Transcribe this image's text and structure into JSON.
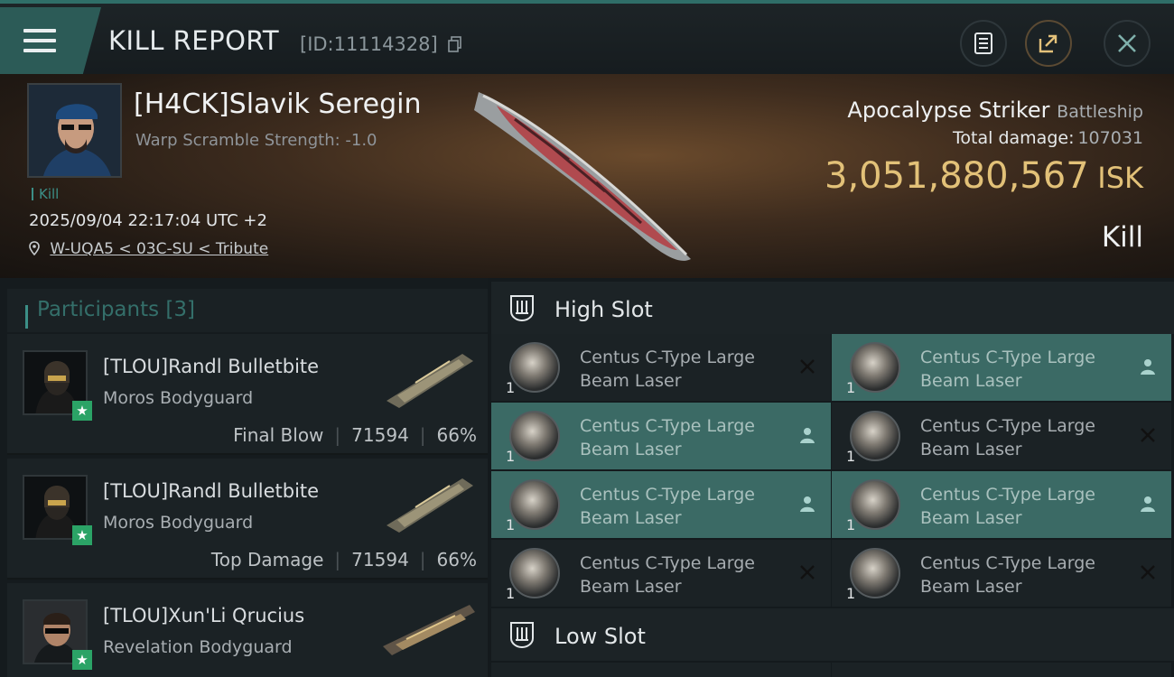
{
  "header": {
    "title": "KILL REPORT",
    "report_id": "[ID:11114328]",
    "icons": [
      "menu-icon",
      "copy-icon",
      "document-icon",
      "share-icon",
      "close-icon"
    ]
  },
  "victim": {
    "name": "[H4CK]Slavik Seregin",
    "warp_scramble": "Warp Scramble Strength: -1.0",
    "tag": "Kill",
    "datetime": "2025/09/04 22:17:04 UTC +2",
    "location": "W-UQA5 < 03C-SU < Tribute",
    "ship_name": "Apocalypse Striker",
    "ship_class": "Battleship",
    "total_damage_label": "Total damage:",
    "total_damage_value": "107031",
    "isk_value": "3,051,880,567",
    "isk_unit": "ISK",
    "result": "Kill"
  },
  "participants": {
    "title": "Participants [3]",
    "rows": [
      {
        "name": "[TLOU]Randl Bulletbite",
        "ship": "Moros Bodyguard",
        "role": "Final Blow",
        "damage": "71594",
        "percent": "66%"
      },
      {
        "name": "[TLOU]Randl Bulletbite",
        "ship": "Moros Bodyguard",
        "role": "Top Damage",
        "damage": "71594",
        "percent": "66%"
      },
      {
        "name": "[TLOU]Xun'Li Qrucius",
        "ship": "Revelation Bodyguard",
        "role": "",
        "damage": "",
        "percent": ""
      }
    ]
  },
  "slots": {
    "high_label": "High Slot",
    "low_label": "Low Slot",
    "modules": [
      {
        "line1": "Centus C-Type Large",
        "line2": "Beam Laser",
        "qty": "1",
        "status": "destroyed"
      },
      {
        "line1": "Centus C-Type Large",
        "line2": "Beam Laser",
        "qty": "1",
        "status": "dropped"
      },
      {
        "line1": "Centus C-Type Large",
        "line2": "Beam Laser",
        "qty": "1",
        "status": "dropped"
      },
      {
        "line1": "Centus C-Type Large",
        "line2": "Beam Laser",
        "qty": "1",
        "status": "destroyed"
      },
      {
        "line1": "Centus C-Type Large",
        "line2": "Beam Laser",
        "qty": "1",
        "status": "dropped"
      },
      {
        "line1": "Centus C-Type Large",
        "line2": "Beam Laser",
        "qty": "1",
        "status": "dropped"
      },
      {
        "line1": "Centus C-Type Large",
        "line2": "Beam Laser",
        "qty": "1",
        "status": "destroyed"
      },
      {
        "line1": "Centus C-Type Large",
        "line2": "Beam Laser",
        "qty": "1",
        "status": "destroyed"
      }
    ]
  },
  "colors": {
    "accent_teal": "#3c8f87",
    "highlight_row": "#3b6a65",
    "isk_gold": "#e2c178",
    "star_green": "#2ba366"
  }
}
